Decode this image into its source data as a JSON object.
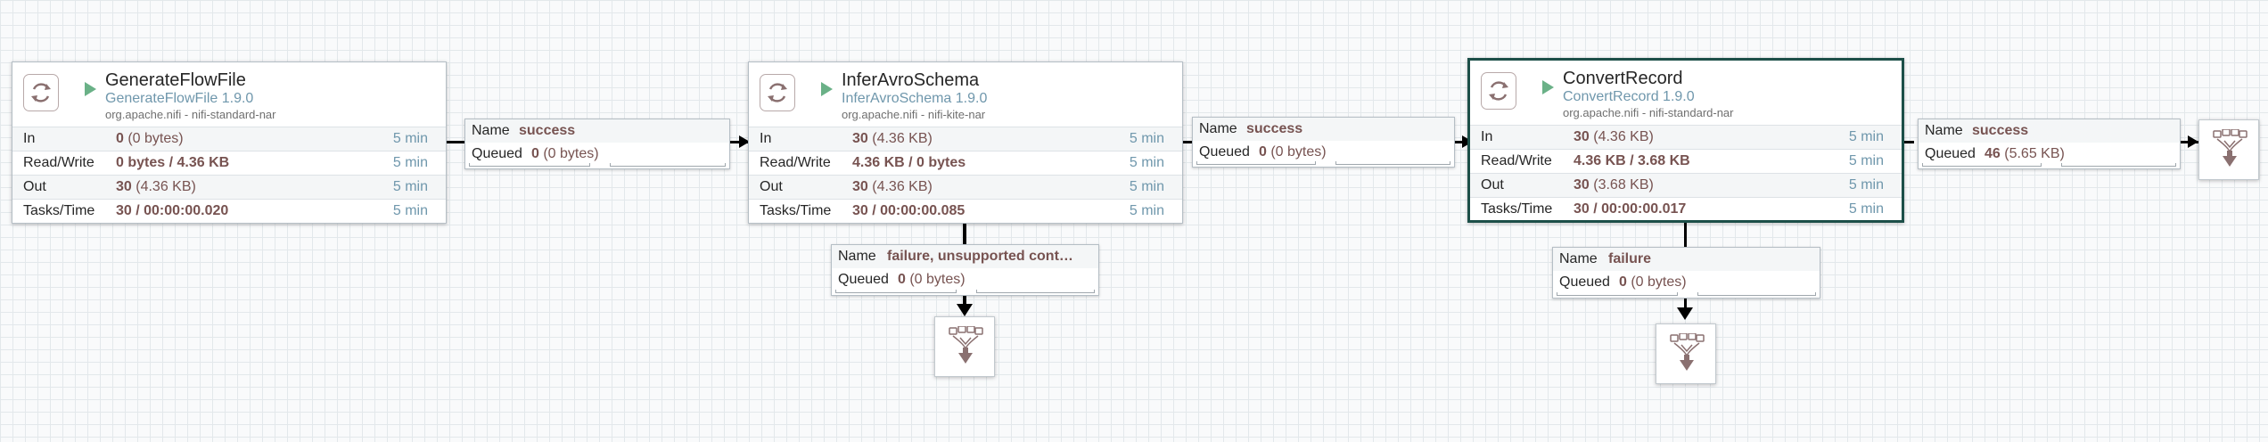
{
  "processors": [
    {
      "name": "GenerateFlowFile",
      "type": "GenerateFlowFile 1.9.0",
      "bundle": "org.apache.nifi - nifi-standard-nar",
      "rows": [
        {
          "label": "In",
          "value": "0",
          "detail": " (0 bytes)",
          "time": "5 min"
        },
        {
          "label": "Read/Write",
          "value": "0 bytes / 4.36 KB",
          "detail": "",
          "time": "5 min"
        },
        {
          "label": "Out",
          "value": "30",
          "detail": " (4.36 KB)",
          "time": "5 min"
        },
        {
          "label": "Tasks/Time",
          "value": "30 / 00:00:00.020",
          "detail": "",
          "time": "5 min"
        }
      ]
    },
    {
      "name": "InferAvroSchema",
      "type": "InferAvroSchema 1.9.0",
      "bundle": "org.apache.nifi - nifi-kite-nar",
      "rows": [
        {
          "label": "In",
          "value": "30",
          "detail": " (4.36 KB)",
          "time": "5 min"
        },
        {
          "label": "Read/Write",
          "value": "4.36 KB / 0 bytes",
          "detail": "",
          "time": "5 min"
        },
        {
          "label": "Out",
          "value": "30",
          "detail": " (4.36 KB)",
          "time": "5 min"
        },
        {
          "label": "Tasks/Time",
          "value": "30 / 00:00:00.085",
          "detail": "",
          "time": "5 min"
        }
      ]
    },
    {
      "name": "ConvertRecord",
      "type": "ConvertRecord 1.9.0",
      "bundle": "org.apache.nifi - nifi-standard-nar",
      "rows": [
        {
          "label": "In",
          "value": "30",
          "detail": " (4.36 KB)",
          "time": "5 min"
        },
        {
          "label": "Read/Write",
          "value": "4.36 KB / 3.68 KB",
          "detail": "",
          "time": "5 min"
        },
        {
          "label": "Out",
          "value": "30",
          "detail": " (3.68 KB)",
          "time": "5 min"
        },
        {
          "label": "Tasks/Time",
          "value": "30 / 00:00:00.017",
          "detail": "",
          "time": "5 min"
        }
      ]
    }
  ],
  "connections": [
    {
      "name_label": "Name",
      "name": "success",
      "queued_label": "Queued",
      "queued_count": "0",
      "queued_size": " (0 bytes)"
    },
    {
      "name_label": "Name",
      "name": "success",
      "queued_label": "Queued",
      "queued_count": "0",
      "queued_size": " (0 bytes)"
    },
    {
      "name_label": "Name",
      "name": "success",
      "queued_label": "Queued",
      "queued_count": "46",
      "queued_size": " (5.65 KB)"
    },
    {
      "name_label": "Name",
      "name": "failure, unsupported cont…",
      "queued_label": "Queued",
      "queued_count": "0",
      "queued_size": " (0 bytes)"
    },
    {
      "name_label": "Name",
      "name": "failure",
      "queued_label": "Queued",
      "queued_count": "0",
      "queued_size": " (0 bytes)"
    }
  ],
  "icons": {
    "processor": "processor-icon",
    "running": "play-icon",
    "funnel": "funnel-icon"
  },
  "colors": {
    "running": "#6ab187",
    "selected_border": "#1c4f48",
    "value_text": "#775351",
    "secondary_text": "#6f97ac"
  }
}
